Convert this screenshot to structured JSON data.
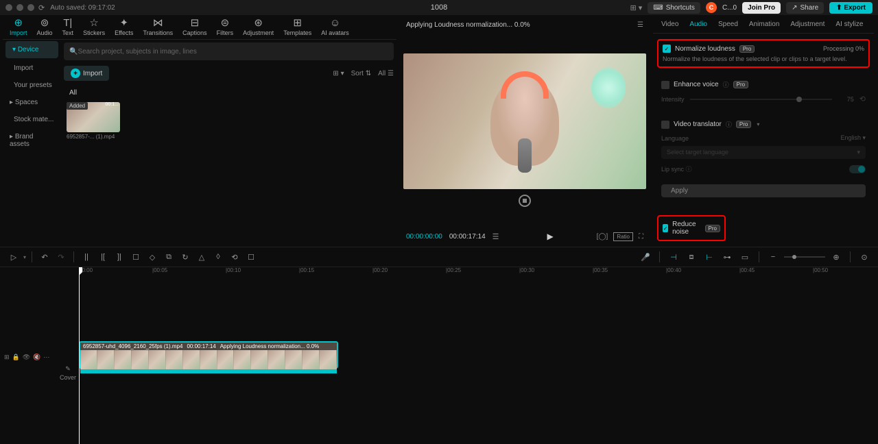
{
  "titlebar": {
    "autosave": "Auto saved: 09:17:02",
    "project_title": "1008",
    "shortcuts": "Shortcuts",
    "user": "C...0",
    "join_pro": "Join Pro",
    "share": "Share",
    "export": "Export"
  },
  "top_tabs": [
    "Import",
    "Audio",
    "Text",
    "Stickers",
    "Effects",
    "Transitions",
    "Captions",
    "Filters",
    "Adjustment",
    "Templates",
    "AI avatars"
  ],
  "side_nav": {
    "device": "Device",
    "import": "Import",
    "your_presets": "Your presets",
    "spaces": "Spaces",
    "stock": "Stock mate...",
    "brand": "Brand assets"
  },
  "media": {
    "search_placeholder": "Search project, subjects in image, lines",
    "import_btn": "Import",
    "sort": "Sort",
    "all_btn": "All",
    "all_label": "All",
    "thumb_added": "Added",
    "thumb_time": "00:1...",
    "thumb_name": "6952857-... (1).mp4"
  },
  "preview": {
    "status": "Applying Loudness normalization... 0.0%",
    "tc_current": "00:00:00:00",
    "tc_total": "00:00:17:14",
    "ratio": "Ratio"
  },
  "props": {
    "tabs": [
      "Video",
      "Audio",
      "Speed",
      "Animation",
      "Adjustment",
      "AI stylize"
    ],
    "normalize": {
      "label": "Normalize loudness",
      "status": "Processing 0%",
      "desc": "Normalize the loudness of the selected clip or clips to a target level."
    },
    "enhance": {
      "label": "Enhance voice",
      "intensity": "Intensity",
      "value": "75"
    },
    "translator": {
      "label": "Video translator",
      "lang_label": "Language",
      "lang_value": "English",
      "select_placeholder": "Select target language",
      "lip_sync": "Lip sync"
    },
    "apply": "Apply",
    "reduce_noise": "Reduce noise",
    "pro_badge": "Pro"
  },
  "timeline": {
    "ruler": [
      "00:00",
      "|00:05",
      "|00:10",
      "|00:15",
      "|00:20",
      "|00:25",
      "|00:30",
      "|00:35",
      "|00:40",
      "|00:45",
      "|00:50"
    ],
    "cover": "Cover",
    "clip_name": "6952857-uhd_4096_2160_25fps (1).mp4",
    "clip_dur": "00:00:17:14",
    "clip_status": "Applying Loudness normalization... 0.0%"
  }
}
